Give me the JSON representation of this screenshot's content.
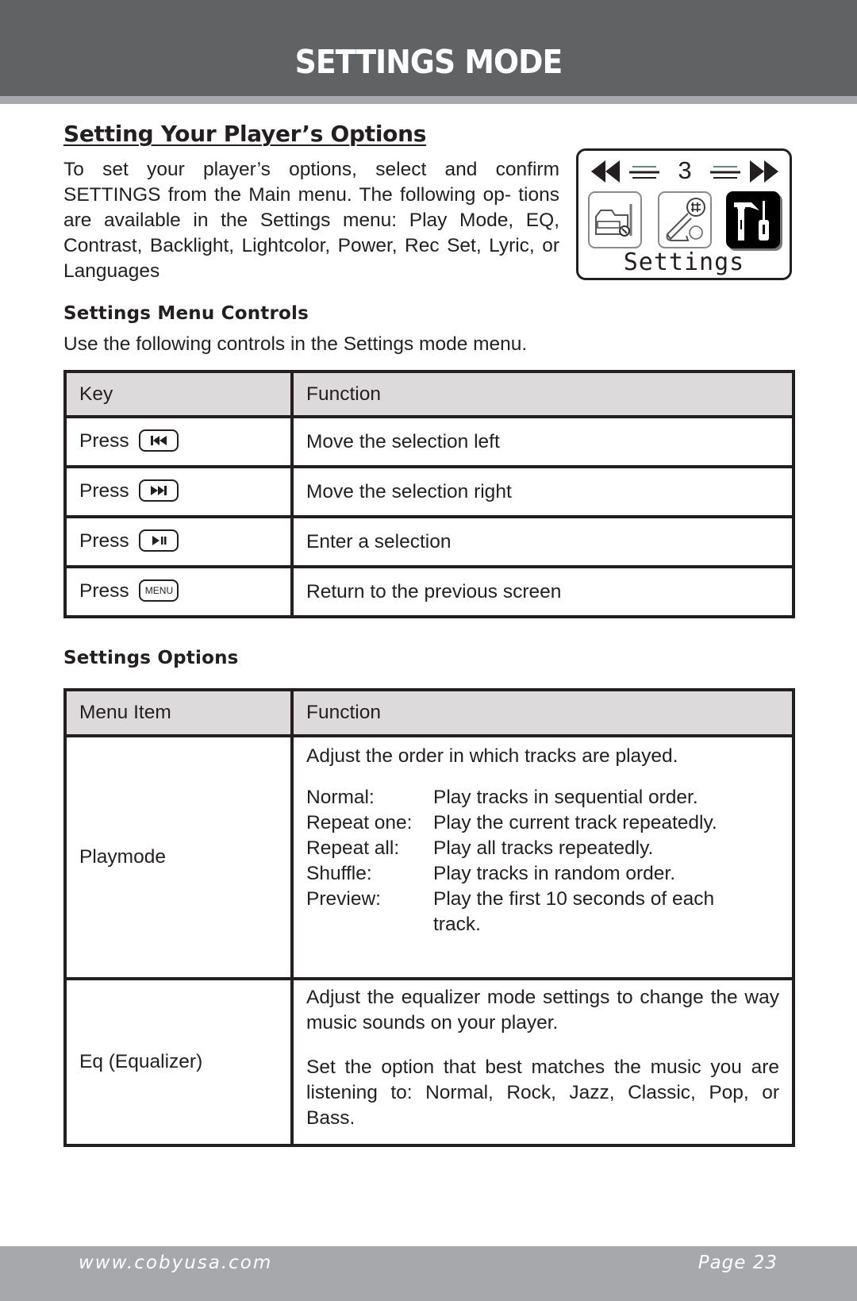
{
  "header": {
    "title": "SETTINGS MODE"
  },
  "section": {
    "title": "Setting Your Player’s Options",
    "intro": "To set your player’s options, select and confirm SETTINGS from the Main menu. The following op- tions are available in the Settings menu: Play Mode, EQ, Contrast, Backlight, Lightcolor, Power, Rec Set, Lyric, or Languages"
  },
  "device_screen": {
    "page_number": "3",
    "label": "Settings",
    "icons": [
      "recorder-icon",
      "tools-wrench-icon",
      "settings-tools-icon"
    ],
    "selected_index": 2
  },
  "controls": {
    "heading": "Settings Menu Controls",
    "lead": "Use the following controls in the Settings mode menu.",
    "headers": [
      "Key",
      "Function"
    ],
    "rows": [
      {
        "press": "Press",
        "key": "previous-track",
        "function": "Move the selection left"
      },
      {
        "press": "Press",
        "key": "next-track",
        "function": "Move the selection right"
      },
      {
        "press": "Press",
        "key": "play-pause",
        "function": "Enter a selection"
      },
      {
        "press": "Press",
        "key": "MENU",
        "function": "Return to the previous screen"
      }
    ]
  },
  "options": {
    "heading": "Settings Options",
    "headers": [
      "Menu Item",
      "Function"
    ],
    "playmode": {
      "item": "Playmode",
      "intro": "Adjust the order in which tracks are played.",
      "modes": [
        {
          "term": "Normal:",
          "desc": "Play tracks in sequential order."
        },
        {
          "term": "Repeat one:",
          "desc": "Play the current track repeatedly."
        },
        {
          "term": "Repeat all:",
          "desc": "Play all tracks repeatedly."
        },
        {
          "term": "Shuffle:",
          "desc": "Play tracks in random order."
        },
        {
          "term": "Preview:",
          "desc": "Play the first 10 seconds of each track."
        }
      ]
    },
    "eq": {
      "item": "Eq (Equalizer)",
      "p1": "Adjust the equalizer mode settings to change the way music sounds on your player.",
      "p2": "Set the option that best matches the music you are listening to: Normal, Rock, Jazz, Classic, Pop, or Bass."
    }
  },
  "footer": {
    "url": "www.cobyusa.com",
    "page": "Page 23"
  }
}
